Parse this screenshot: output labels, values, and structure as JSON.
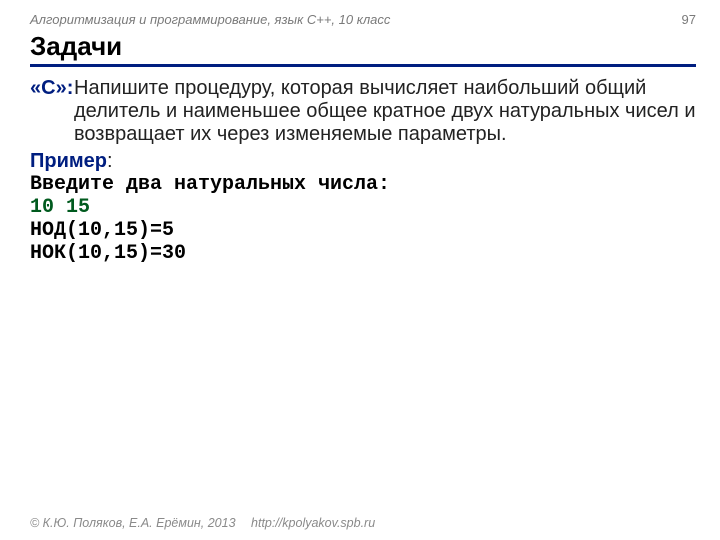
{
  "header": {
    "course": "Алгоритмизация и программирование, язык  C++, 10 класс",
    "page": "97"
  },
  "title": "Задачи",
  "task": {
    "label": "«C»:",
    "text": "Напишите процедуру, которая вычисляет наибольший общий делитель и наименьшее общее кратное двух натуральных чисел и возвращает их через изменяемые параметры."
  },
  "example_label": "Пример",
  "example_colon": ":",
  "console": {
    "prompt": "Введите два натуральных числа:",
    "input": "10 15",
    "out1": "НОД(10,15)=5",
    "out2": "НОК(10,15)=30"
  },
  "footer": {
    "copyright": "© К.Ю. Поляков, Е.А. Ерёмин, 2013",
    "url": "http://kpolyakov.spb.ru"
  }
}
